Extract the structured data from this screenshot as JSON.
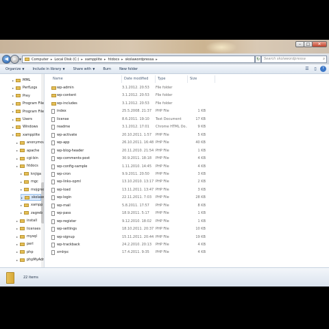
{
  "address": {
    "segments": [
      "Computer",
      "Local Disk (C:)",
      "xampplite",
      "htdocs",
      "skolawordpressa"
    ]
  },
  "search": {
    "placeholder": "Search skolawordpressa"
  },
  "toolbar": {
    "organize": "Organize",
    "include_in_library": "Include in library",
    "share_with": "Share with",
    "burn": "Burn",
    "new_folder": "New folder"
  },
  "nav_tree": [
    {
      "label": "MML",
      "indent": 0
    },
    {
      "label": "PerfLogs",
      "indent": 0
    },
    {
      "label": "Prey",
      "indent": 0
    },
    {
      "label": "Program Files",
      "indent": 0
    },
    {
      "label": "Program Files (",
      "indent": 0
    },
    {
      "label": "Users",
      "indent": 0
    },
    {
      "label": "Windows",
      "indent": 0
    },
    {
      "label": "xampplite",
      "indent": 0
    },
    {
      "label": "anonymous",
      "indent": 1
    },
    {
      "label": "apache",
      "indent": 1
    },
    {
      "label": "cgi-bin",
      "indent": 1
    },
    {
      "label": "htdocs",
      "indent": 1
    },
    {
      "label": "knjiga",
      "indent": 2
    },
    {
      "label": "mgc",
      "indent": 2
    },
    {
      "label": "mojgredice",
      "indent": 2
    },
    {
      "label": "skolawordp",
      "indent": 2,
      "selected": true
    },
    {
      "label": "xampp",
      "indent": 2
    },
    {
      "label": "zagreb",
      "indent": 2
    },
    {
      "label": "install",
      "indent": 1
    },
    {
      "label": "licenses",
      "indent": 1
    },
    {
      "label": "mysql",
      "indent": 1
    },
    {
      "label": "perl",
      "indent": 1
    },
    {
      "label": "php",
      "indent": 1
    },
    {
      "label": "phpMyAdmi",
      "indent": 1
    }
  ],
  "columns": {
    "name": "Name",
    "date": "Date modified",
    "type": "Type",
    "size": "Size"
  },
  "files": [
    {
      "name": "wp-admin",
      "date": "3.1.2012. 20:53",
      "type": "File folder",
      "size": "",
      "kind": "folder"
    },
    {
      "name": "wp-content",
      "date": "3.1.2012. 20:53",
      "type": "File folder",
      "size": "",
      "kind": "folder"
    },
    {
      "name": "wp-includes",
      "date": "3.1.2012. 20:53",
      "type": "File folder",
      "size": "",
      "kind": "folder"
    },
    {
      "name": "index",
      "date": "25.5.2008. 21:37",
      "type": "PHP File",
      "size": "1 KB",
      "kind": "file"
    },
    {
      "name": "license",
      "date": "8.6.2011. 19:10",
      "type": "Text Document",
      "size": "17 KB",
      "kind": "file"
    },
    {
      "name": "readme",
      "date": "3.1.2012. 17:01",
      "type": "Chrome HTML Do...",
      "size": "9 KB",
      "kind": "file"
    },
    {
      "name": "wp-activate",
      "date": "20.10.2011. 1:57",
      "type": "PHP File",
      "size": "5 KB",
      "kind": "file"
    },
    {
      "name": "wp-app",
      "date": "26.10.2011. 16:48",
      "type": "PHP File",
      "size": "40 KB",
      "kind": "file"
    },
    {
      "name": "wp-blog-header",
      "date": "20.11.2010. 21:54",
      "type": "PHP File",
      "size": "1 KB",
      "kind": "file"
    },
    {
      "name": "wp-comments-post",
      "date": "30.9.2011. 18:18",
      "type": "PHP File",
      "size": "4 KB",
      "kind": "file"
    },
    {
      "name": "wp-config-sample",
      "date": "1.11.2010. 14:45",
      "type": "PHP File",
      "size": "4 KB",
      "kind": "file"
    },
    {
      "name": "wp-cron",
      "date": "9.9.2011. 20:50",
      "type": "PHP File",
      "size": "3 KB",
      "kind": "file"
    },
    {
      "name": "wp-links-opml",
      "date": "13.10.2010. 13:17",
      "type": "PHP File",
      "size": "2 KB",
      "kind": "file"
    },
    {
      "name": "wp-load",
      "date": "13.11.2011. 13:47",
      "type": "PHP File",
      "size": "3 KB",
      "kind": "file"
    },
    {
      "name": "wp-login",
      "date": "22.11.2011. 7:03",
      "type": "PHP File",
      "size": "28 KB",
      "kind": "file"
    },
    {
      "name": "wp-mail",
      "date": "5.8.2011. 17:57",
      "type": "PHP File",
      "size": "8 KB",
      "kind": "file"
    },
    {
      "name": "wp-pass",
      "date": "18.9.2011. 5:17",
      "type": "PHP File",
      "size": "1 KB",
      "kind": "file"
    },
    {
      "name": "wp-register",
      "date": "9.12.2010. 18:02",
      "type": "PHP File",
      "size": "1 KB",
      "kind": "file"
    },
    {
      "name": "wp-settings",
      "date": "18.10.2011. 20:37",
      "type": "PHP File",
      "size": "10 KB",
      "kind": "file"
    },
    {
      "name": "wp-signup",
      "date": "15.11.2011. 20:44",
      "type": "PHP File",
      "size": "19 KB",
      "kind": "file"
    },
    {
      "name": "wp-trackback",
      "date": "24.2.2010. 20:13",
      "type": "PHP File",
      "size": "4 KB",
      "kind": "file"
    },
    {
      "name": "xmlrpc",
      "date": "17.4.2011. 9:35",
      "type": "PHP File",
      "size": "4 KB",
      "kind": "file"
    }
  ],
  "status": {
    "items_count": "22 items"
  }
}
